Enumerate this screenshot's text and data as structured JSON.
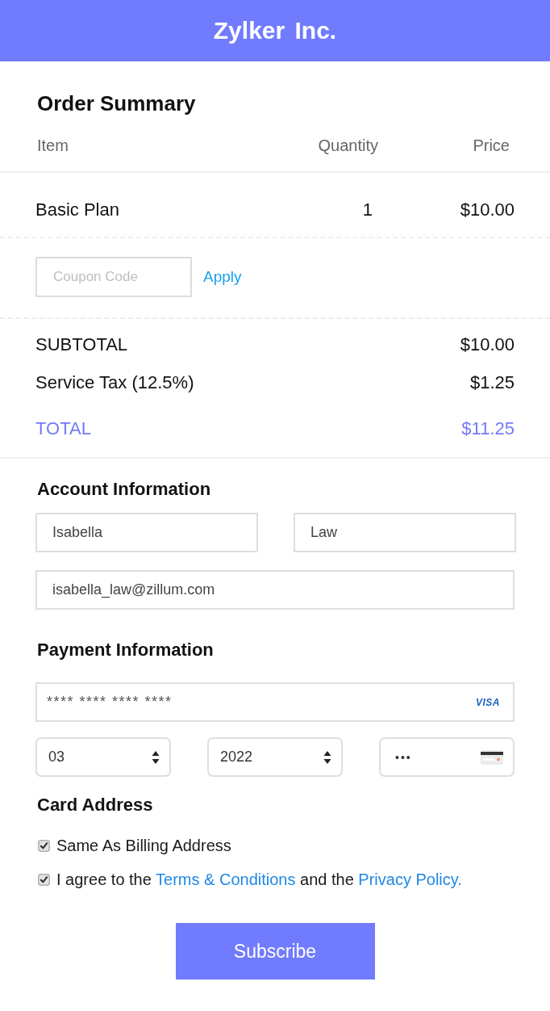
{
  "header": {
    "title": "Zylker Inc."
  },
  "order_summary": {
    "title": "Order Summary",
    "columns": [
      "Item",
      "Quantity",
      "Price"
    ],
    "rows": [
      {
        "cells": [
          "Basic Plan",
          "1",
          "$10.00"
        ]
      }
    ]
  },
  "coupon": {
    "placeholder": "Coupon Code",
    "action": "Apply"
  },
  "totals": [
    {
      "kind": "line",
      "label": "SUBTOTAL",
      "amount": "$10.00"
    },
    {
      "kind": "line",
      "label": "Service Tax (12.5%)",
      "amount": "$1.25"
    },
    {
      "kind": "grand",
      "label": "TOTAL",
      "amount": "$11.25"
    }
  ],
  "account_information": {
    "title": "Account Information",
    "first_name": {
      "value": "Isabella"
    },
    "last_name": {
      "value": "Law"
    },
    "email": {
      "value": "isabella_law@zillum.com"
    }
  },
  "payment_information": {
    "title": "Payment Information",
    "card_number": {
      "value": "**** **** **** ****",
      "brand": "VISA"
    },
    "expiry_month": {
      "value": "03"
    },
    "expiry_year": {
      "value": "2022"
    },
    "cvv": {
      "value": "•••"
    }
  },
  "card_address": {
    "title": "Card Address",
    "options": [
      {
        "kind": "plain",
        "checked": true,
        "label": "Same As Billing Address"
      },
      {
        "kind": "agreement",
        "checked": true,
        "parts": [
          {
            "kind": "text",
            "text": "I agree to the "
          },
          {
            "kind": "link",
            "text": "Terms & Conditions"
          },
          {
            "kind": "text",
            "text": " and the "
          },
          {
            "kind": "link",
            "text": "Privacy Policy."
          }
        ]
      }
    ]
  },
  "subscribe_button": {
    "label": "Subscribe"
  }
}
